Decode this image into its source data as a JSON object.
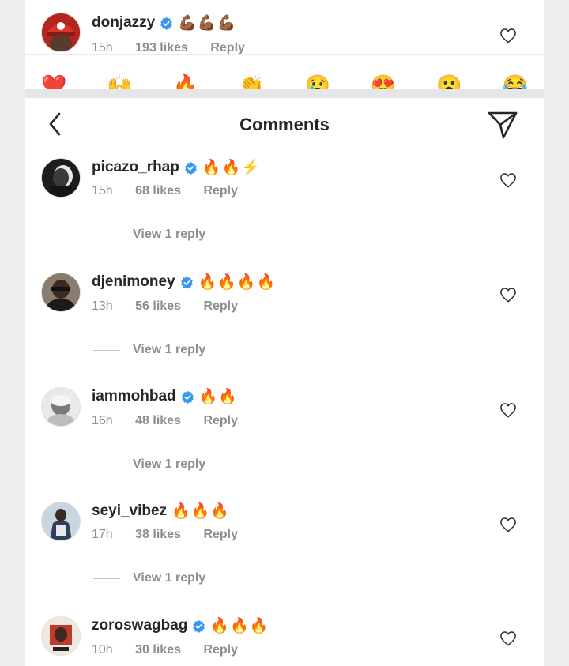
{
  "top_comment": {
    "username": "donjazzy",
    "emojis": "💪🏾💪🏾💪🏾",
    "time": "15h",
    "likes": "193 likes",
    "reply": "Reply"
  },
  "emoji_bar": [
    "❤️",
    "🙌",
    "🔥",
    "👏",
    "😢",
    "😍",
    "😮",
    "😂"
  ],
  "header": {
    "title": "Comments"
  },
  "comments": [
    {
      "username": "picazo_rhap",
      "verified": true,
      "emojis": "🔥🔥⚡",
      "time": "15h",
      "likes": "68 likes",
      "reply": "Reply",
      "view_replies": "View 1 reply"
    },
    {
      "username": "djenimoney",
      "verified": true,
      "emojis": "🔥🔥🔥🔥",
      "time": "13h",
      "likes": "56 likes",
      "reply": "Reply",
      "view_replies": "View 1 reply"
    },
    {
      "username": "iammohbad",
      "verified": true,
      "emojis": "🔥🔥",
      "time": "16h",
      "likes": "48 likes",
      "reply": "Reply",
      "view_replies": "View 1 reply"
    },
    {
      "username": "seyi_vibez",
      "verified": false,
      "emojis": "🔥🔥🔥",
      "time": "17h",
      "likes": "38 likes",
      "reply": "Reply",
      "view_replies": "View 1 reply"
    },
    {
      "username": "zoroswagbag",
      "verified": true,
      "emojis": "🔥🔥🔥",
      "time": "10h",
      "likes": "30 likes",
      "reply": "Reply"
    }
  ],
  "colors": {
    "verified": "#3897f0",
    "muted": "#8e8e8e",
    "text": "#262626"
  }
}
